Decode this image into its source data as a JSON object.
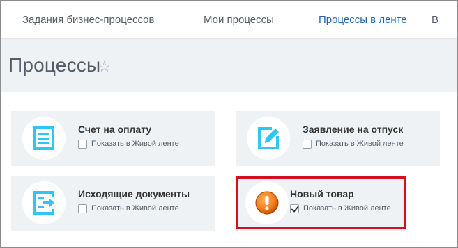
{
  "tabs": [
    {
      "label": "Задания бизнес-процессов"
    },
    {
      "label": "Мои процессы"
    },
    {
      "label": "Процессы в ленте",
      "active": true
    },
    {
      "label": "В"
    }
  ],
  "page": {
    "title": "Процессы",
    "favorite_icon": "star-outline-icon"
  },
  "cards": [
    {
      "title": "Счет на оплату",
      "checkbox_label": "Показать в Живой ленте",
      "checked": false,
      "icon": "invoice-icon",
      "icon_color": "#2fc6f6"
    },
    {
      "title": "Заявление на отпуск",
      "checkbox_label": "Показать в Живой ленте",
      "checked": false,
      "icon": "edit-document-icon",
      "icon_color": "#2fc6f6"
    },
    {
      "title": "Исходящие документы",
      "checkbox_label": "Показать в Живой ленте",
      "checked": false,
      "icon": "outgoing-document-icon",
      "icon_color": "#2fc6f6"
    },
    {
      "title": "Новый товар",
      "checkbox_label": "Показать в Живой ленте",
      "checked": true,
      "icon": "warning-exclamation-icon",
      "icon_color": "#f07b1a"
    }
  ],
  "colors": {
    "accent": "#2067b0",
    "highlight": "#d40f1c"
  }
}
